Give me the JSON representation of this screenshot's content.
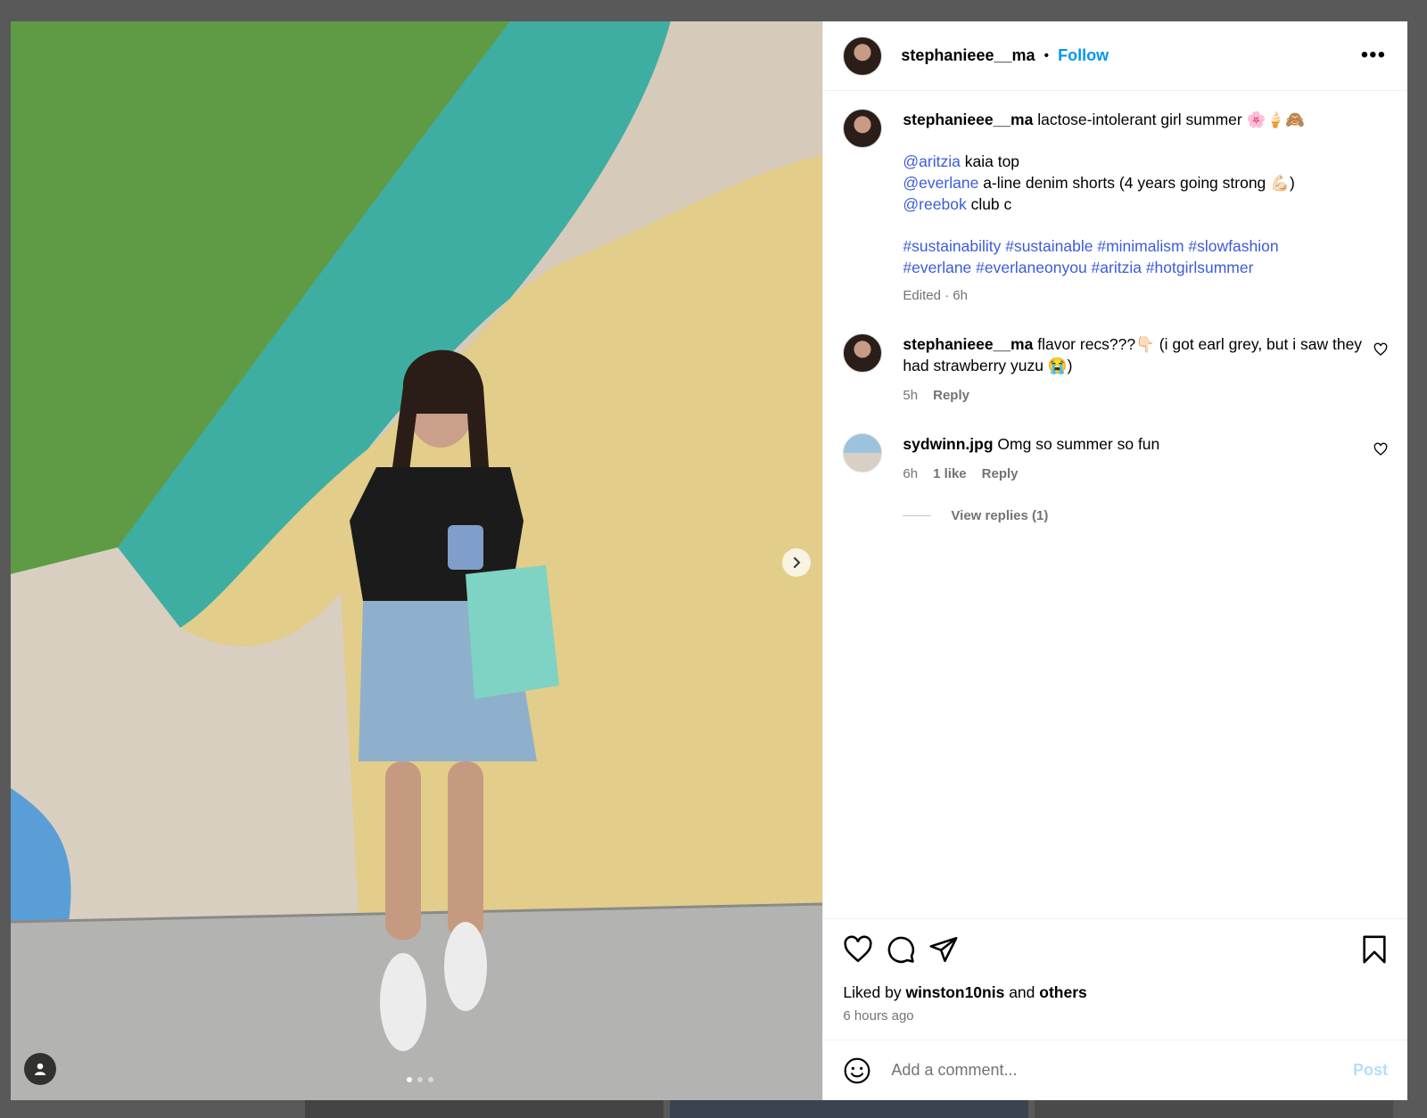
{
  "post": {
    "author": "stephanieee__ma",
    "separator": "•",
    "follow_label": "Follow",
    "more_label": "•••",
    "carousel": {
      "slide_count": 3,
      "active_index": 0
    }
  },
  "caption": {
    "username": "stephanieee__ma",
    "text": " lactose-intolerant girl summer 🌸🍦🙈",
    "lines": [
      {
        "mention": "@aritzia",
        "text": " kaia top"
      },
      {
        "mention": "@everlane",
        "text": " a-line denim shorts (4 years going strong 💪🏻)"
      },
      {
        "mention": "@reebok",
        "text": " club c"
      }
    ],
    "hashtags_line1": "#sustainability #sustainable #minimalism #slowfashion",
    "hashtags_line2": "#everlane #everlaneonyou #aritzia #hotgirlsummer",
    "meta": "Edited · 6h"
  },
  "comments": [
    {
      "username": "stephanieee__ma",
      "text": " flavor recs???👇🏻 (i got earl grey, but i saw they had strawberry yuzu 😭)",
      "time": "5h",
      "likes": "",
      "reply_label": "Reply"
    },
    {
      "username": "sydwinn.jpg",
      "text": " Omg so summer so fun",
      "time": "6h",
      "likes": "1 like",
      "reply_label": "Reply",
      "view_replies": "View replies (1)"
    }
  ],
  "footer": {
    "liked_prefix": "Liked by ",
    "liked_user": "winston10nis",
    "liked_and": " and ",
    "liked_others": "others",
    "timestamp": "6 hours ago",
    "comment_placeholder": "Add a comment...",
    "post_label": "Post"
  }
}
